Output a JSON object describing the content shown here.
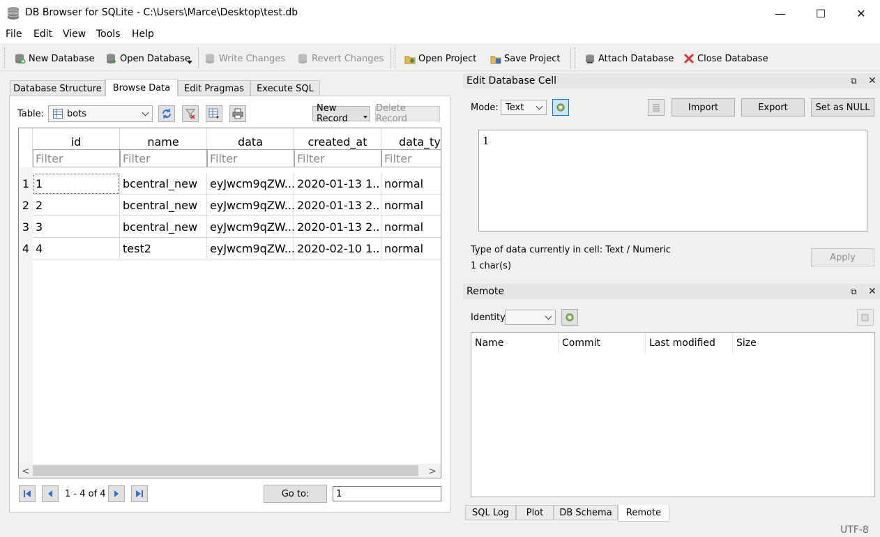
{
  "window": {
    "title": "DB Browser for SQLite - C:\\Users\\Marce\\Desktop\\test.db",
    "controls": {
      "minimize": "—",
      "maximize": "☐",
      "close": "✕"
    }
  },
  "menu": [
    "File",
    "Edit",
    "View",
    "Tools",
    "Help"
  ],
  "toolbar": {
    "new_database": "New Database",
    "open_database": "Open Database",
    "write_changes": "Write Changes",
    "revert_changes": "Revert Changes",
    "open_project": "Open Project",
    "save_project": "Save Project",
    "attach_database": "Attach Database",
    "close_database": "Close Database"
  },
  "tabs": [
    "Database Structure",
    "Browse Data",
    "Edit Pragmas",
    "Execute SQL"
  ],
  "browse": {
    "table_label": "Table:",
    "table_value": "bots",
    "new_record": "New Record",
    "delete_record": "Delete Record",
    "columns": [
      "id",
      "name",
      "data",
      "created_at",
      "data_typ"
    ],
    "filter_placeholder": "Filter",
    "rows": [
      {
        "num": "1",
        "cells": [
          "1",
          "bcentral_new",
          "eyJwcm9qZW...",
          "2020-01-13 1...",
          "normal"
        ]
      },
      {
        "num": "2",
        "cells": [
          "2",
          "bcentral_new",
          "eyJwcm9qZW...",
          "2020-01-13 2...",
          "normal"
        ]
      },
      {
        "num": "3",
        "cells": [
          "3",
          "bcentral_new",
          "eyJwcm9qZW...",
          "2020-01-13 2...",
          "normal"
        ]
      },
      {
        "num": "4",
        "cells": [
          "4",
          "test2",
          "eyJwcm9qZW...",
          "2020-02-10 1...",
          "normal"
        ]
      }
    ],
    "record_count": "1 - 4 of 4",
    "goto_label": "Go to:",
    "goto_value": "1"
  },
  "edit_cell": {
    "title": "Edit Database Cell",
    "mode_label": "Mode:",
    "mode_value": "Text",
    "import": "Import",
    "export": "Export",
    "set_null": "Set as NULL",
    "content": "1",
    "type_info": "Type of data currently in cell: Text / Numeric",
    "size_info": "1 char(s)",
    "apply": "Apply"
  },
  "remote": {
    "title": "Remote",
    "identity_label": "Identity",
    "columns": [
      "Name",
      "Commit",
      "Last modified",
      "Size"
    ]
  },
  "bottom_tabs": [
    "SQL Log",
    "Plot",
    "DB Schema",
    "Remote"
  ],
  "status": {
    "encoding": "UTF-8"
  },
  "colors": {
    "accent_blue": "#2f6fd6",
    "close_red": "#e03030",
    "selection": "#0078d7"
  }
}
